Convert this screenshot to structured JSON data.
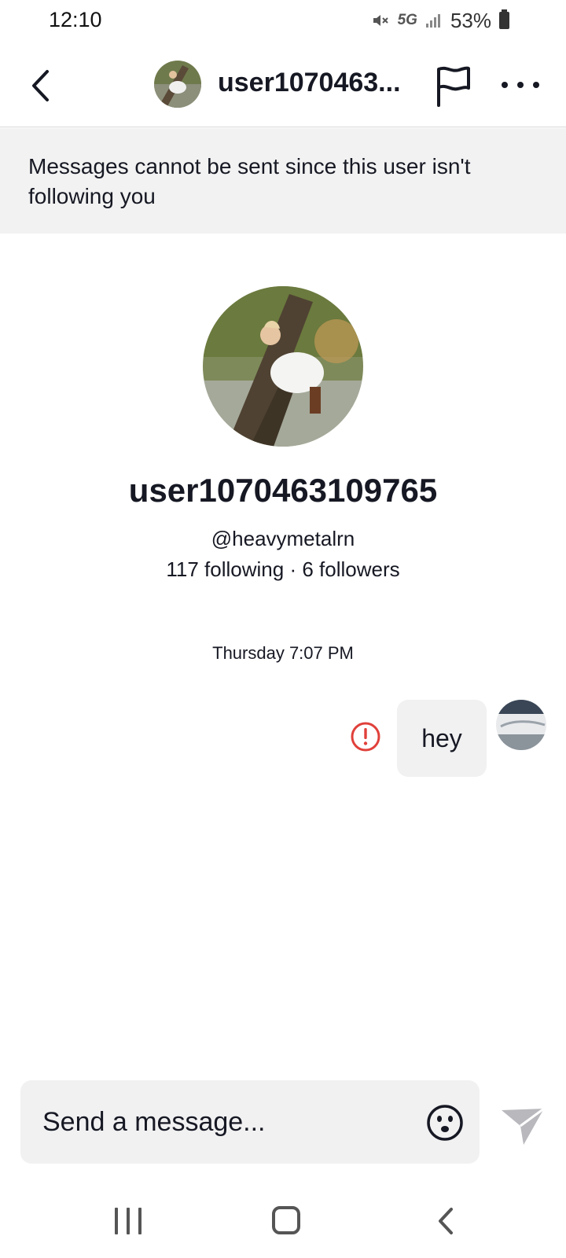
{
  "status_bar": {
    "time": "12:10",
    "network": "5G",
    "battery": "53%"
  },
  "header": {
    "username": "user1070463...",
    "icons": [
      "back-arrow-icon",
      "avatar",
      "flag-icon",
      "more-icon"
    ]
  },
  "banner": {
    "text": "Messages cannot be sent since this user isn't following you"
  },
  "profile": {
    "display_name": "user1070463109765",
    "handle": "@heavymetalrn",
    "stats": "117 following · 6 followers"
  },
  "conversation": {
    "timestamp": "Thursday 7:07 PM",
    "messages": [
      {
        "text": "hey",
        "from": "me",
        "status": "failed"
      }
    ]
  },
  "composer": {
    "placeholder": "Send a message...",
    "icons": [
      "emoji-icon",
      "send-icon"
    ]
  },
  "colors": {
    "error": "#e0403a",
    "banner_bg": "#f2f2f2",
    "bubble_bg": "#f1f1f2",
    "send_icon": "#b8b8bd"
  }
}
